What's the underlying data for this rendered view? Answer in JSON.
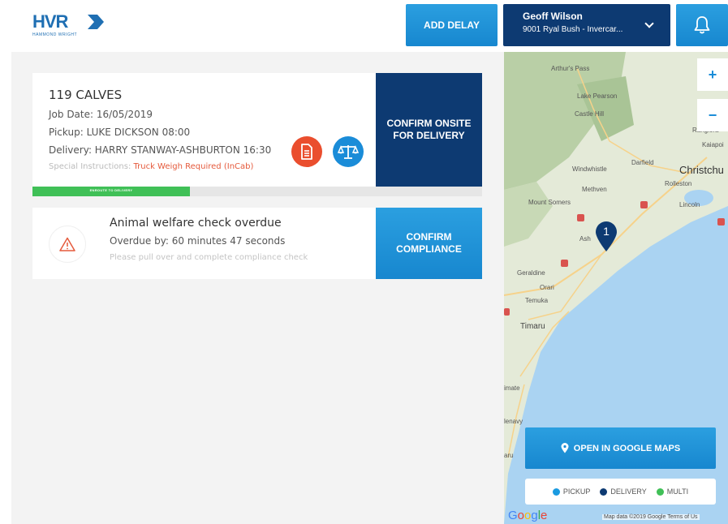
{
  "header": {
    "logo_text": "HVR",
    "logo_subtext": "HAMMOND WRIGHT",
    "add_delay_label": "ADD DELAY",
    "user_name": "Geoff Wilson",
    "user_location": "9001 Ryal Bush - Invercar..."
  },
  "job": {
    "title": "119 CALVES",
    "job_date": "Job Date: 16/05/2019",
    "pickup": "Pickup: LUKE DICKSON 08:00",
    "delivery": "Delivery: HARRY STANWAY-ASHBURTON 16:30",
    "special_prefix": "Special Instructions: ",
    "special_value": "Truck Weigh Required (InCab)",
    "confirm_label": "CONFIRM ONSITE FOR DELIVERY",
    "progress_label": "ENROUTE TO DELIVERY",
    "progress_fraction": 0.35
  },
  "welfare": {
    "title": "Animal welfare check overdue",
    "overdue": "Overdue by: 60 minutes 47 seconds",
    "note": "Please pull over and complete compliance check",
    "confirm_label": "CONFIRM COMPLIANCE"
  },
  "map": {
    "labels": {
      "arthurs_pass": "Arthur's Pass",
      "lake_pearson": "Lake Pearson",
      "castle_hill": "Castle Hill",
      "rangiora": "Rangiora",
      "kaiapoi": "Kaiapoi",
      "windwhistle": "Windwhistle",
      "darfield": "Darfield",
      "christchurch": "Christchu",
      "rolleston": "Rolleston",
      "methven": "Methven",
      "mount_somers": "Mount Somers",
      "lincoln": "Lincoln",
      "ashburton": "Ash",
      "geraldine": "Geraldine",
      "orari": "Orari",
      "temuka": "Temuka",
      "timaru": "Timaru",
      "waimate": "imate",
      "glenavy": "lenavy",
      "oamaru": "aru"
    },
    "marker_number": "1",
    "zoom_in": "+",
    "zoom_out": "−",
    "open_label": "OPEN IN GOOGLE MAPS",
    "legend": [
      {
        "label": "PICKUP",
        "color": "#1a9ae0"
      },
      {
        "label": "DELIVERY",
        "color": "#0d3a72"
      },
      {
        "label": "MULTI",
        "color": "#40c057"
      }
    ],
    "google": "Google",
    "attribution": "Map data ©2019 Google   Terms of Us"
  },
  "colors": {
    "navy": "#0d3a72",
    "blue": "#1a8cd8",
    "green": "#40c057",
    "red": "#ea4e2e"
  }
}
